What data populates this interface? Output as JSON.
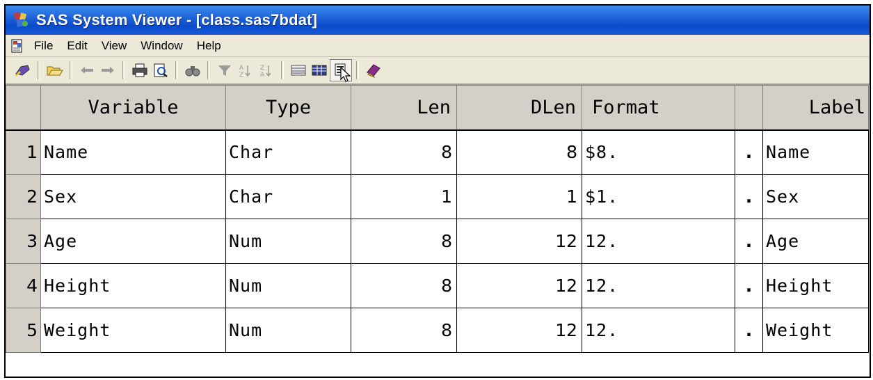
{
  "window": {
    "title": "SAS System Viewer - [class.sas7bdat]"
  },
  "menu": {
    "items": [
      "File",
      "Edit",
      "View",
      "Window",
      "Help"
    ]
  },
  "toolbar": {
    "buttons": [
      "open-table-icon",
      "open-folder-icon",
      "back-arrow-icon",
      "forward-arrow-icon",
      "print-icon",
      "print-preview-icon",
      "find-binoculars-icon",
      "filter-funnel-icon",
      "sort-ascending-icon",
      "sort-descending-icon",
      "column-view-icon",
      "detail-view-icon",
      "properties-view-icon",
      "book-help-icon"
    ]
  },
  "table": {
    "headers": [
      "Variable",
      "Type",
      "Len",
      "DLen",
      "Format",
      "",
      "Label"
    ],
    "rows": [
      {
        "num": "1",
        "variable": "Name",
        "type": "Char",
        "len": "8",
        "dlen": "8",
        "format": "$8.",
        "informat": ".",
        "label": "Name"
      },
      {
        "num": "2",
        "variable": "Sex",
        "type": "Char",
        "len": "1",
        "dlen": "1",
        "format": "$1.",
        "informat": ".",
        "label": "Sex"
      },
      {
        "num": "3",
        "variable": "Age",
        "type": "Num",
        "len": "8",
        "dlen": "12",
        "format": "12.",
        "informat": ".",
        "label": "Age"
      },
      {
        "num": "4",
        "variable": "Height",
        "type": "Num",
        "len": "8",
        "dlen": "12",
        "format": "12.",
        "informat": ".",
        "label": "Height"
      },
      {
        "num": "5",
        "variable": "Weight",
        "type": "Num",
        "len": "8",
        "dlen": "12",
        "format": "12.",
        "informat": ".",
        "label": "Weight"
      }
    ]
  }
}
